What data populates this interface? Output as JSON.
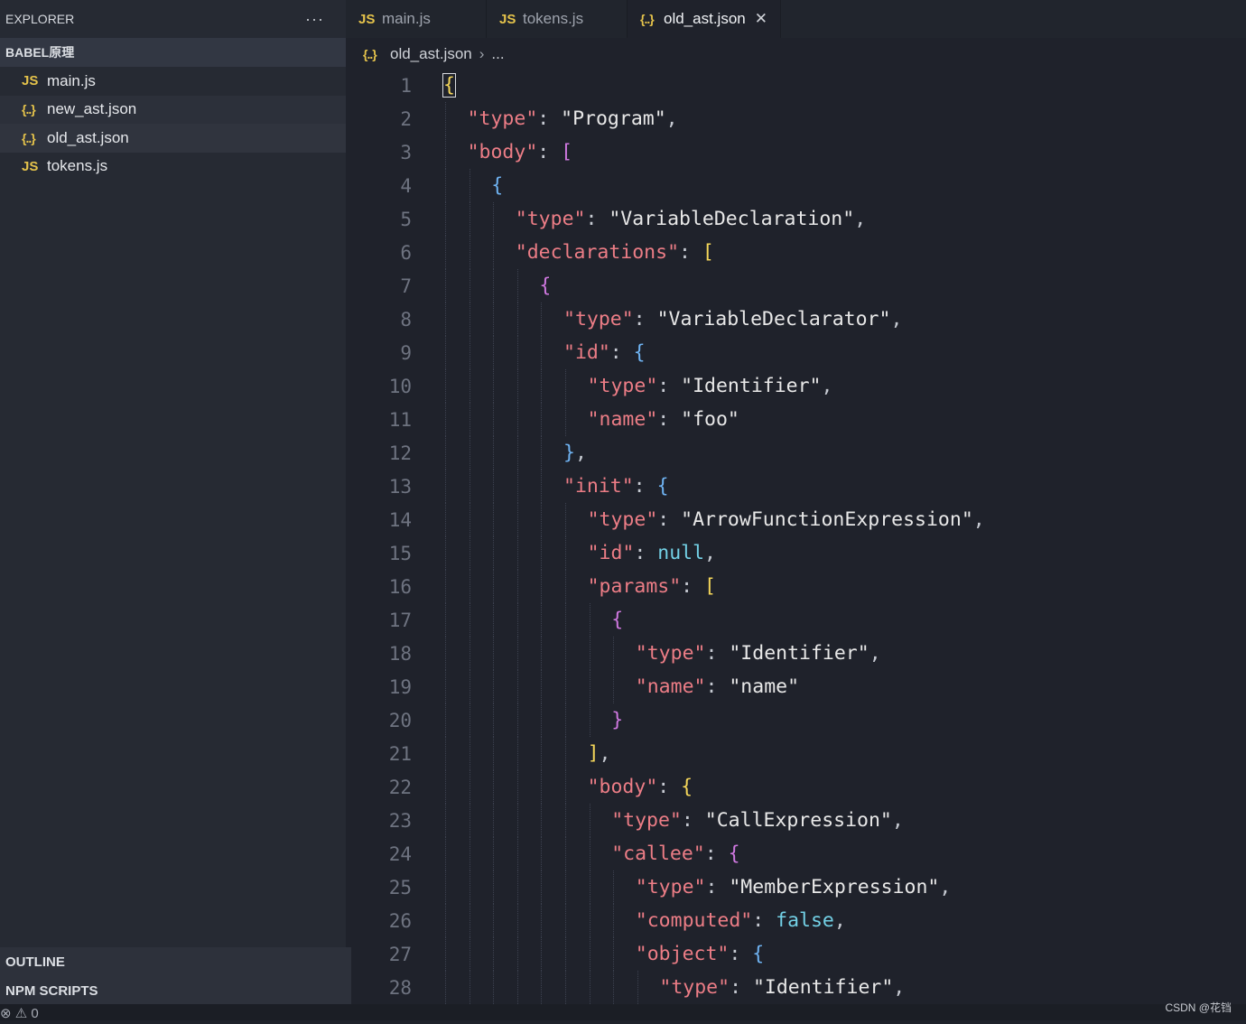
{
  "explorer": {
    "title": "EXPLORER",
    "more": "···",
    "section": "BABEL原理",
    "files": [
      {
        "icon": "JS",
        "name": "main.js"
      },
      {
        "icon": "{..}",
        "name": "new_ast.json"
      },
      {
        "icon": "{..}",
        "name": "old_ast.json"
      },
      {
        "icon": "JS",
        "name": "tokens.js"
      }
    ],
    "outline": "OUTLINE",
    "npm_scripts": "NPM SCRIPTS"
  },
  "tabs": [
    {
      "icon": "JS",
      "label": "main.js"
    },
    {
      "icon": "JS",
      "label": "tokens.js"
    },
    {
      "icon": "{..}",
      "label": "old_ast.json",
      "close": "✕"
    }
  ],
  "breadcrumb": {
    "icon": "{..}",
    "file": "old_ast.json",
    "sep": "›",
    "rest": "..."
  },
  "status": {
    "left": "⊗ ⚠ 0"
  },
  "watermark": "CSDN @花铛",
  "code": [
    {
      "n": "1",
      "i": 0,
      "t": [
        [
          "b1",
          "{"
        ]
      ]
    },
    {
      "n": "2",
      "i": 1,
      "t": [
        [
          "k",
          "\"type\""
        ],
        [
          "p",
          ": "
        ],
        [
          "s",
          "\"Program\""
        ],
        [
          "p",
          ","
        ]
      ]
    },
    {
      "n": "3",
      "i": 1,
      "t": [
        [
          "k",
          "\"body\""
        ],
        [
          "p",
          ": "
        ],
        [
          "b2",
          "["
        ]
      ]
    },
    {
      "n": "4",
      "i": 2,
      "t": [
        [
          "b3",
          "{"
        ]
      ]
    },
    {
      "n": "5",
      "i": 3,
      "t": [
        [
          "k",
          "\"type\""
        ],
        [
          "p",
          ": "
        ],
        [
          "s",
          "\"VariableDeclaration\""
        ],
        [
          "p",
          ","
        ]
      ]
    },
    {
      "n": "6",
      "i": 3,
      "t": [
        [
          "k",
          "\"declarations\""
        ],
        [
          "p",
          ": "
        ],
        [
          "b1",
          "["
        ]
      ]
    },
    {
      "n": "7",
      "i": 4,
      "t": [
        [
          "b2",
          "{"
        ]
      ]
    },
    {
      "n": "8",
      "i": 5,
      "t": [
        [
          "k",
          "\"type\""
        ],
        [
          "p",
          ": "
        ],
        [
          "s",
          "\"VariableDeclarator\""
        ],
        [
          "p",
          ","
        ]
      ]
    },
    {
      "n": "9",
      "i": 5,
      "t": [
        [
          "k",
          "\"id\""
        ],
        [
          "p",
          ": "
        ],
        [
          "b3",
          "{"
        ]
      ]
    },
    {
      "n": "10",
      "i": 6,
      "t": [
        [
          "k",
          "\"type\""
        ],
        [
          "p",
          ": "
        ],
        [
          "s",
          "\"Identifier\""
        ],
        [
          "p",
          ","
        ]
      ]
    },
    {
      "n": "11",
      "i": 6,
      "t": [
        [
          "k",
          "\"name\""
        ],
        [
          "p",
          ": "
        ],
        [
          "s",
          "\"foo\""
        ]
      ]
    },
    {
      "n": "12",
      "i": 5,
      "t": [
        [
          "b3",
          "}"
        ],
        [
          "p",
          ","
        ]
      ]
    },
    {
      "n": "13",
      "i": 5,
      "t": [
        [
          "k",
          "\"init\""
        ],
        [
          "p",
          ": "
        ],
        [
          "b3",
          "{"
        ]
      ]
    },
    {
      "n": "14",
      "i": 6,
      "t": [
        [
          "k",
          "\"type\""
        ],
        [
          "p",
          ": "
        ],
        [
          "s",
          "\"ArrowFunctionExpression\""
        ],
        [
          "p",
          ","
        ]
      ]
    },
    {
      "n": "15",
      "i": 6,
      "t": [
        [
          "k",
          "\"id\""
        ],
        [
          "p",
          ": "
        ],
        [
          "n",
          "null"
        ],
        [
          "p",
          ","
        ]
      ]
    },
    {
      "n": "16",
      "i": 6,
      "t": [
        [
          "k",
          "\"params\""
        ],
        [
          "p",
          ": "
        ],
        [
          "b1",
          "["
        ]
      ]
    },
    {
      "n": "17",
      "i": 7,
      "t": [
        [
          "b2",
          "{"
        ]
      ]
    },
    {
      "n": "18",
      "i": 8,
      "t": [
        [
          "k",
          "\"type\""
        ],
        [
          "p",
          ": "
        ],
        [
          "s",
          "\"Identifier\""
        ],
        [
          "p",
          ","
        ]
      ]
    },
    {
      "n": "19",
      "i": 8,
      "t": [
        [
          "k",
          "\"name\""
        ],
        [
          "p",
          ": "
        ],
        [
          "s",
          "\"name\""
        ]
      ]
    },
    {
      "n": "20",
      "i": 7,
      "t": [
        [
          "b2",
          "}"
        ]
      ]
    },
    {
      "n": "21",
      "i": 6,
      "t": [
        [
          "b1",
          "]"
        ],
        [
          "p",
          ","
        ]
      ]
    },
    {
      "n": "22",
      "i": 6,
      "t": [
        [
          "k",
          "\"body\""
        ],
        [
          "p",
          ": "
        ],
        [
          "b1",
          "{"
        ]
      ]
    },
    {
      "n": "23",
      "i": 7,
      "t": [
        [
          "k",
          "\"type\""
        ],
        [
          "p",
          ": "
        ],
        [
          "s",
          "\"CallExpression\""
        ],
        [
          "p",
          ","
        ]
      ]
    },
    {
      "n": "24",
      "i": 7,
      "t": [
        [
          "k",
          "\"callee\""
        ],
        [
          "p",
          ": "
        ],
        [
          "b2",
          "{"
        ]
      ]
    },
    {
      "n": "25",
      "i": 8,
      "t": [
        [
          "k",
          "\"type\""
        ],
        [
          "p",
          ": "
        ],
        [
          "s",
          "\"MemberExpression\""
        ],
        [
          "p",
          ","
        ]
      ]
    },
    {
      "n": "26",
      "i": 8,
      "t": [
        [
          "k",
          "\"computed\""
        ],
        [
          "p",
          ": "
        ],
        [
          "n",
          "false"
        ],
        [
          "p",
          ","
        ]
      ]
    },
    {
      "n": "27",
      "i": 8,
      "t": [
        [
          "k",
          "\"object\""
        ],
        [
          "p",
          ": "
        ],
        [
          "b3",
          "{"
        ]
      ]
    },
    {
      "n": "28",
      "i": 9,
      "t": [
        [
          "k",
          "\"type\""
        ],
        [
          "p",
          ": "
        ],
        [
          "s",
          "\"Identifier\""
        ],
        [
          "p",
          ","
        ]
      ]
    }
  ]
}
